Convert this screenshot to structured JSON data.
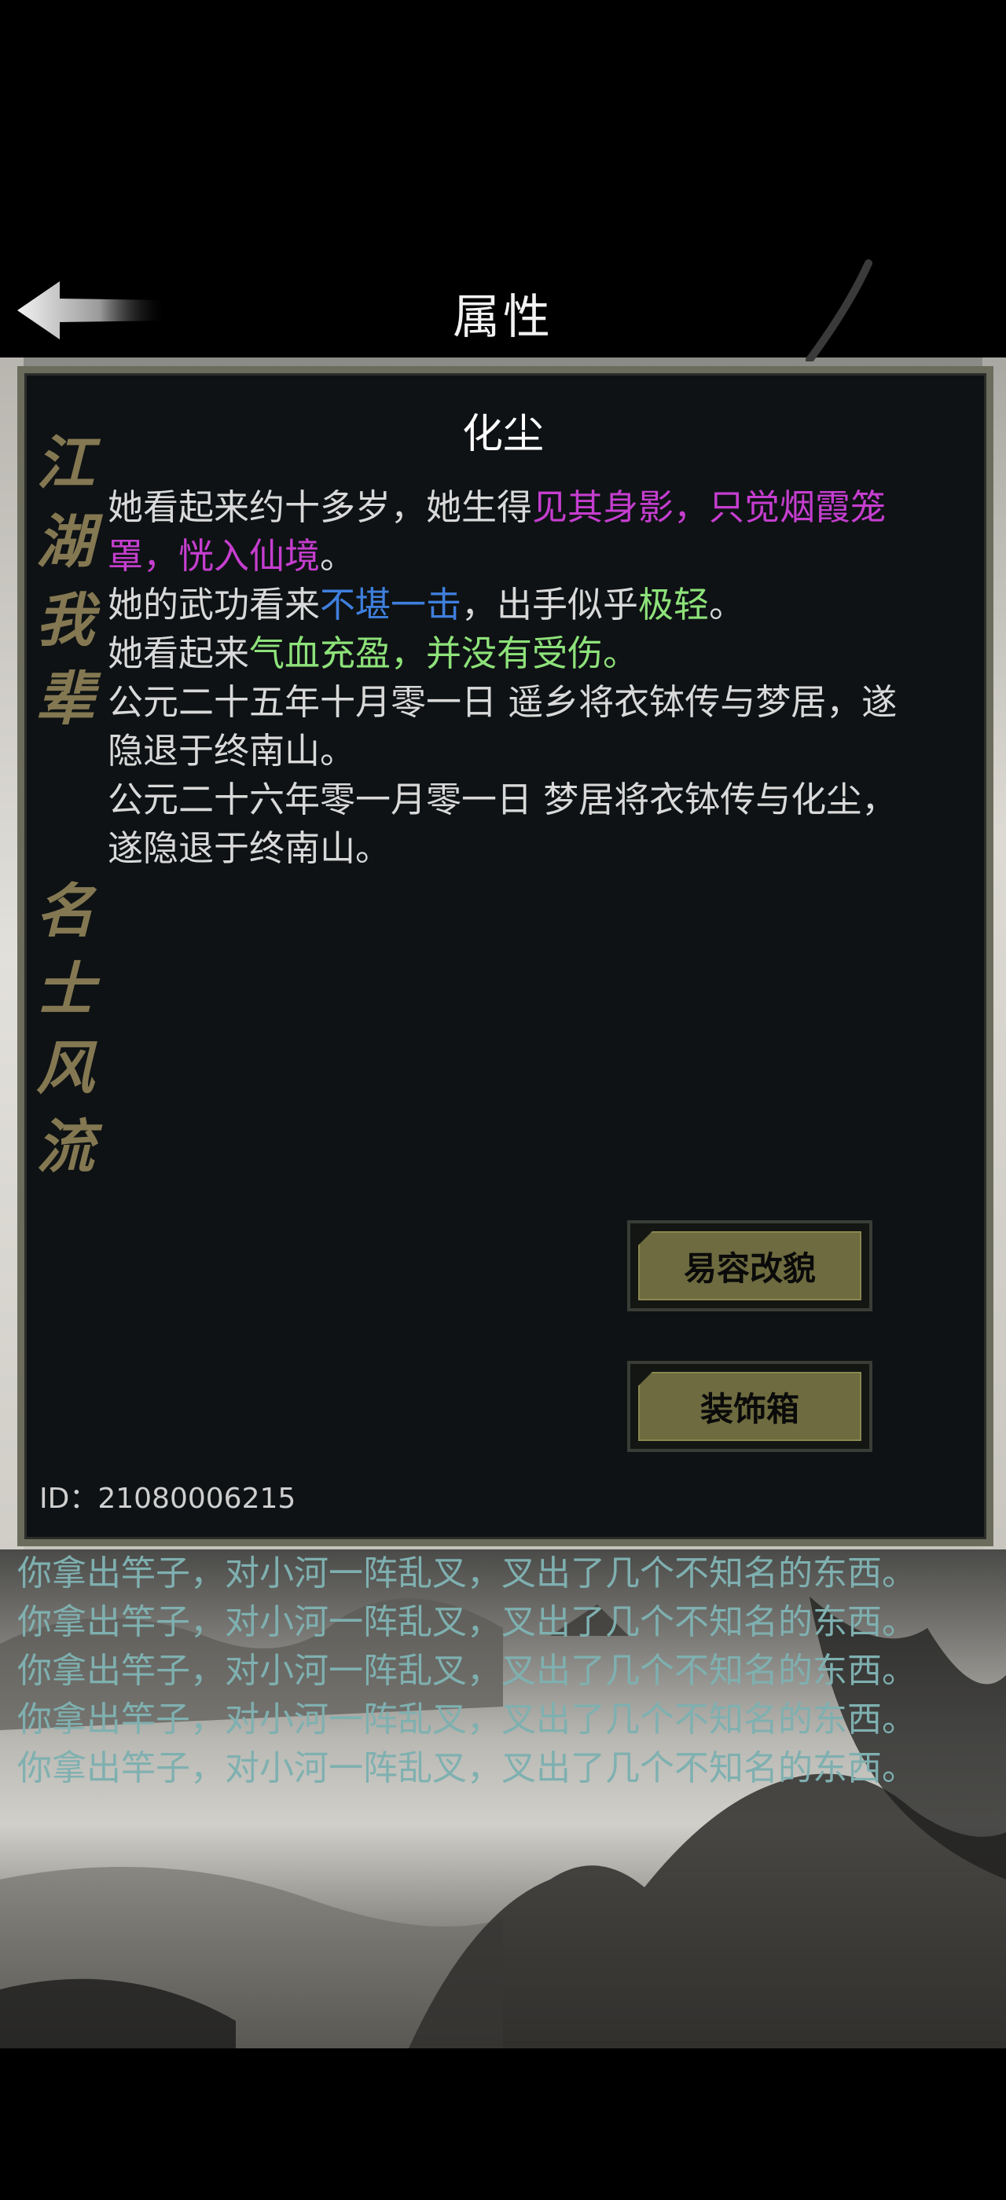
{
  "header": {
    "title": "属性"
  },
  "panel": {
    "calligraphy_top": [
      "江",
      "湖",
      "我",
      "辈"
    ],
    "calligraphy_bottom": [
      "名",
      "士",
      "风",
      "流"
    ],
    "character_name": "化尘",
    "bio": {
      "line1_pre": "她看起来约十多岁，她生得",
      "line1_highlight": "见其身影，只觉烟霞笼罩，恍入仙境",
      "line1_post": "。",
      "line2_pre": "她的武功看来",
      "line2_highlight_blue": "不堪一击",
      "line2_mid": "，出手似乎",
      "line2_highlight_green": "极轻",
      "line2_post": "。",
      "line3_pre": "她看起来",
      "line3_highlight": "气血充盈，并没有受伤。",
      "history1": "公元二十五年十月零一日 遥乡将衣钵传与梦居，遂隐退于终南山。",
      "history2": "公元二十六年零一月零一日 梦居将衣钵传与化尘，遂隐退于终南山。"
    },
    "buttons": {
      "disguise": "易容改貌",
      "wardrobe": "装饰箱"
    },
    "player_id": "ID：21080006215"
  },
  "log": {
    "lines": [
      "你拿出竿子，对小河一阵乱叉，叉出了几个不知名的东西。",
      "你拿出竿子，对小河一阵乱叉，叉出了几个不知名的东西。",
      "你拿出竿子，对小河一阵乱叉，叉出了几个不知名的东西。",
      "你拿出竿子，对小河一阵乱叉，叉出了几个不知名的东西。",
      "你拿出竿子，对小河一阵乱叉，叉出了几个不知名的东西。"
    ]
  },
  "colors": {
    "purple_highlight": "#c53ecf",
    "blue_highlight": "#3f7fdc",
    "green_highlight": "#8ee27a",
    "button_face": "#6d6b3f",
    "panel_border": "#6c6c5c",
    "log_text": "#7fb0b0"
  },
  "icons": {
    "back": "back-arrow-icon"
  }
}
